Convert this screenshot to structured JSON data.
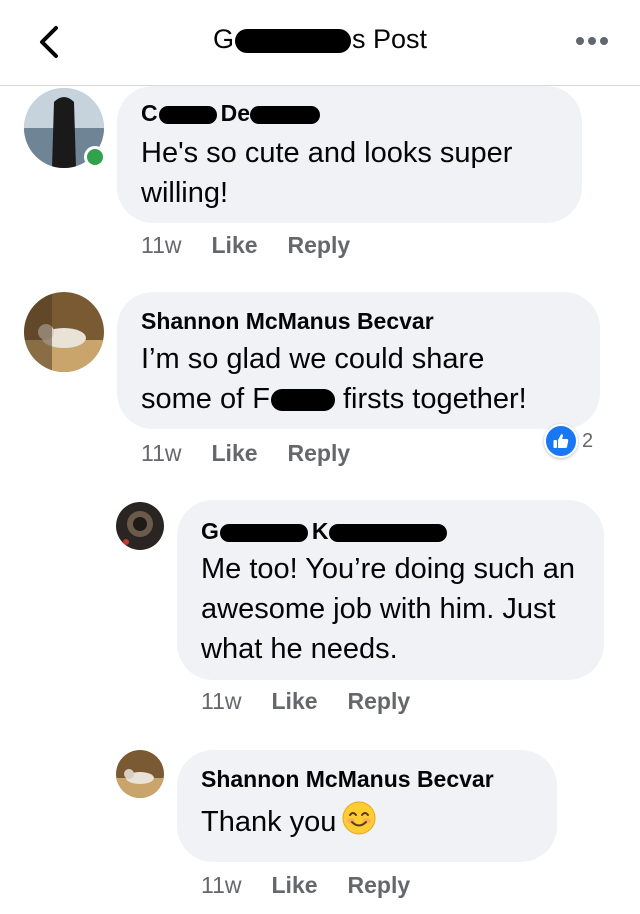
{
  "header": {
    "title_prefix": "G",
    "title_suffix": "s Post"
  },
  "comments": [
    {
      "name_prefix": "C",
      "name_mid": "De",
      "text": "He's so cute and looks super willing!",
      "time": "11w",
      "like_label": "Like",
      "reply_label": "Reply",
      "online": true
    },
    {
      "name": "Shannon McManus Becvar",
      "text_line1": "I’m so glad we could share",
      "text_prefix": "some of F",
      "text_suffix": " firsts together!",
      "time": "11w",
      "like_label": "Like",
      "reply_label": "Reply",
      "reaction_count": "2"
    },
    {
      "name_prefix": "G",
      "name_mid": "K",
      "text": "Me too! You’re doing such an awesome job with him. Just what he needs.",
      "time": "11w",
      "like_label": "Like",
      "reply_label": "Reply"
    },
    {
      "name": "Shannon McManus Becvar",
      "text": "Thank you",
      "emoji": "smiling-face-emoji",
      "time": "11w",
      "like_label": "Like",
      "reply_label": "Reply"
    }
  ],
  "colors": {
    "bubble": "#f0f2f5",
    "meta": "#65676b",
    "like_blue": "#1877f2",
    "online_green": "#31a24c"
  }
}
